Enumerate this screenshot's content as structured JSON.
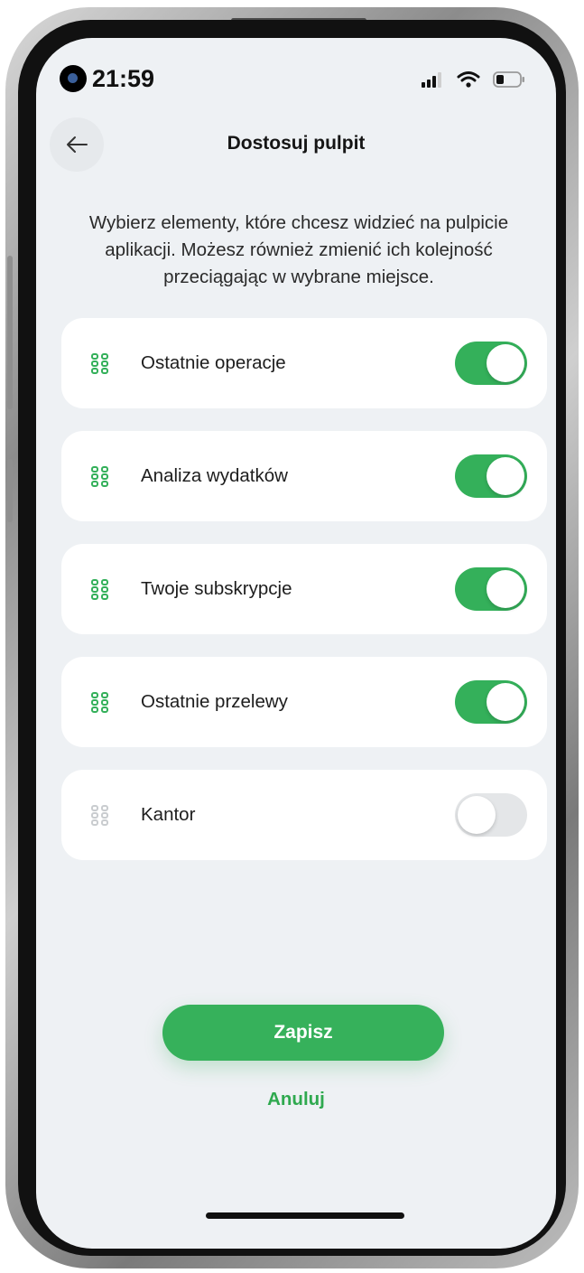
{
  "status_bar": {
    "time": "21:59",
    "icons": [
      "camera-icon",
      "signal-icon",
      "wifi-icon",
      "battery-icon"
    ]
  },
  "header": {
    "back_icon": "arrow-left-icon",
    "title": "Dostosuj pulpit"
  },
  "instructions": "Wybierz elementy, które chcesz widzieć na pulpicie aplikacji. Możesz również zmienić ich kolejność przeciągając w wybrane miejsce.",
  "items": [
    {
      "label": "Ostatnie operacje",
      "enabled": true
    },
    {
      "label": "Analiza wydatków",
      "enabled": true
    },
    {
      "label": "Twoje subskrypcje",
      "enabled": true
    },
    {
      "label": "Ostatnie przelewy",
      "enabled": true
    },
    {
      "label": "Kantor",
      "enabled": false
    }
  ],
  "actions": {
    "save_label": "Zapisz",
    "cancel_label": "Anuluj"
  },
  "colors": {
    "accent": "#34b05a",
    "screen_background": "#eef1f4",
    "card_background": "#ffffff",
    "toggle_off": "#e4e6e8"
  }
}
